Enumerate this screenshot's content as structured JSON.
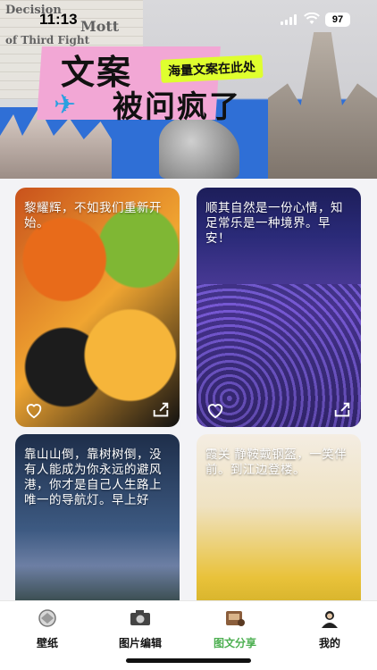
{
  "status": {
    "time": "11:13",
    "battery": "97"
  },
  "banner": {
    "title_line1": "文案",
    "title_line2": "被问疯了",
    "tag": "海量文案在此处",
    "paper_words": [
      "Decision",
      "Mott",
      "of Third Fight"
    ]
  },
  "cards": [
    {
      "text": "黎耀辉，不如我们重新开始。",
      "image": "autumn-leaves-with-dew"
    },
    {
      "text": "顺其自然是一份心情，知足常乐是一种境界。早安！",
      "image": "purple-flower-field-night"
    },
    {
      "text": "靠山山倒，靠树树倒，没有人能成为你永远的避风港，你才是自己人生路上唯一的导航灯。早上好",
      "image": "mountain-lake-house-night"
    },
    {
      "text": "霞关 静鞍戴钢盔，一笑伴前。到江边登楼。",
      "image": "pagoda-yellow-trees"
    }
  ],
  "card_actions": {
    "like_icon": "heart-icon",
    "share_icon": "share-icon"
  },
  "tabs": [
    {
      "label": "壁纸",
      "icon": "wallpaper-icon",
      "active": false
    },
    {
      "label": "图片编辑",
      "icon": "camera-icon",
      "active": false
    },
    {
      "label": "图文分享",
      "icon": "share-card-icon",
      "active": true
    },
    {
      "label": "我的",
      "icon": "avatar-icon",
      "active": false
    }
  ],
  "colors": {
    "active_tab": "#4caf50",
    "banner_blue": "#2f6fd6",
    "title_pink": "#f2a7d5",
    "tag_yellow": "#dfff2e"
  }
}
